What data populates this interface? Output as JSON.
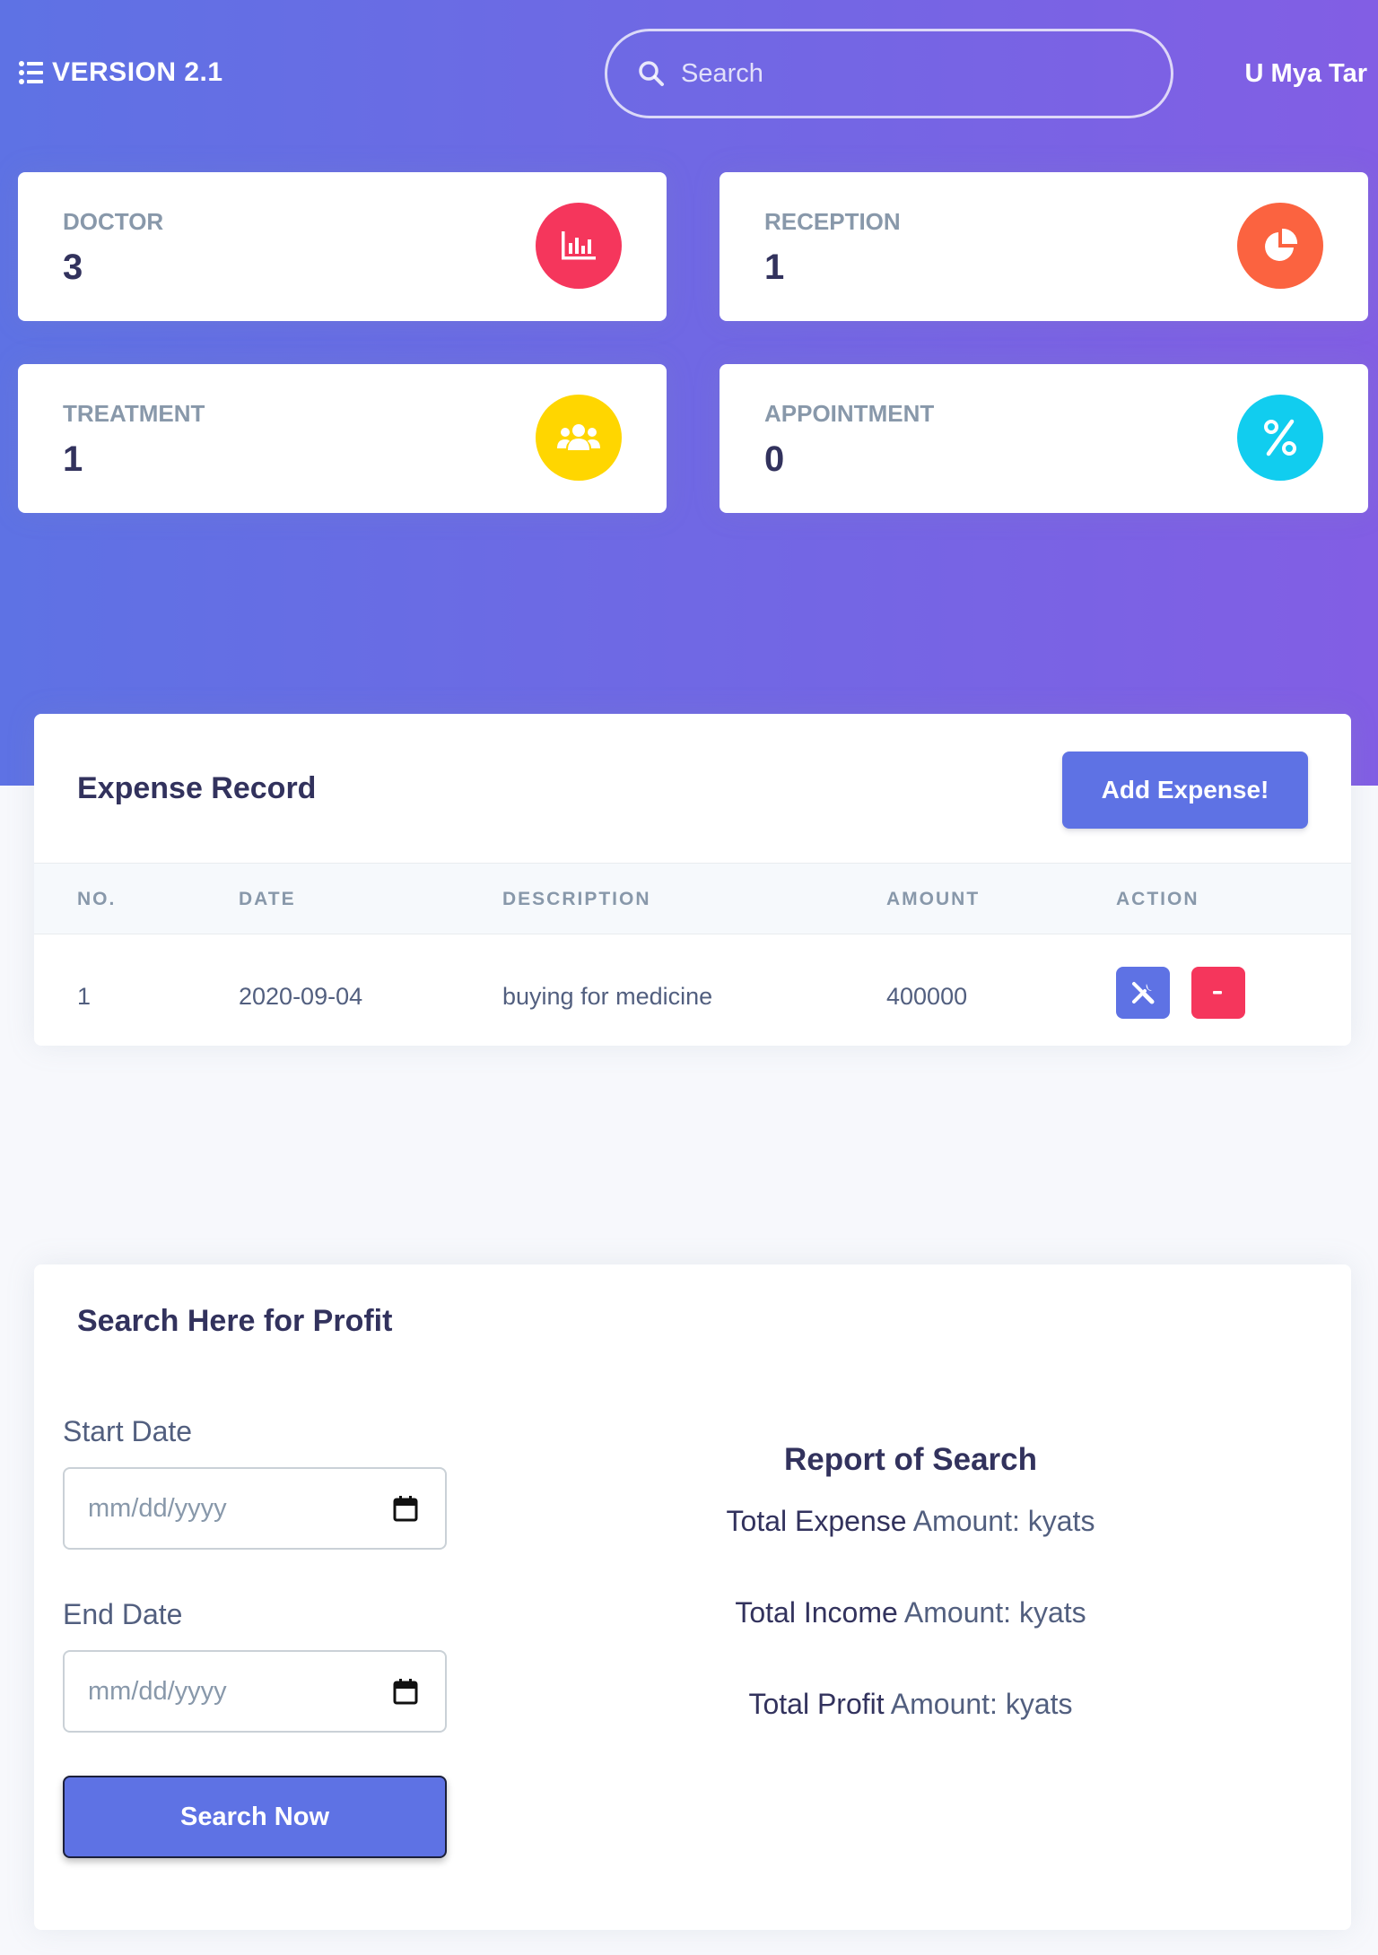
{
  "header": {
    "brand": "VERSION 2.1",
    "search_placeholder": "Search",
    "user_name": "U Mya Tar"
  },
  "stats": [
    {
      "title": "DOCTOR",
      "value": "3",
      "icon": "bar-chart-icon",
      "color": "#f5365c"
    },
    {
      "title": "RECEPTION",
      "value": "1",
      "icon": "pie-chart-icon",
      "color": "#fb6340"
    },
    {
      "title": "TREATMENT",
      "value": "1",
      "icon": "users-icon",
      "color": "#ffd600"
    },
    {
      "title": "APPOINTMENT",
      "value": "0",
      "icon": "percent-icon",
      "color": "#11cdef"
    }
  ],
  "expense": {
    "title": "Expense Record",
    "add_button": "Add Expense!",
    "columns": [
      "NO.",
      "DATE",
      "DESCRIPTION",
      "AMOUNT",
      "ACTION"
    ],
    "rows": [
      {
        "no": "1",
        "date": "2020-09-04",
        "description": "buying for medicine",
        "amount": "400000"
      }
    ],
    "edit_icon": "tools-icon",
    "delete_icon": "minus-icon",
    "edit_color": "#5e72e4",
    "delete_color": "#f5365c"
  },
  "profit": {
    "title": "Search Here for Profit",
    "start_label": "Start Date",
    "start_placeholder": "mm/dd/yyyy",
    "end_label": "End Date",
    "end_placeholder": "mm/dd/yyyy",
    "search_button": "Search Now",
    "report_title": "Report of Search",
    "report_lines": [
      {
        "label": "Total Expense",
        "suffix": "Amount: kyats"
      },
      {
        "label": "Total Income",
        "suffix": "Amount: kyats"
      },
      {
        "label": "Total Profit",
        "suffix": "Amount: kyats"
      }
    ]
  },
  "colors": {
    "primary": "#5e72e4",
    "gradient_end": "#825ee4"
  }
}
